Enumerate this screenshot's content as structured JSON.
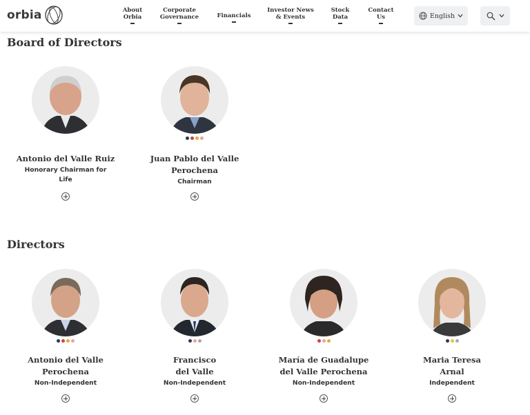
{
  "header": {
    "logo_text": "orbia",
    "nav": [
      {
        "line1": "About",
        "line2": "Orbia"
      },
      {
        "line1": "Corporate",
        "line2": "Governance"
      },
      {
        "line1": "Financials",
        "line2": ""
      },
      {
        "line1": "Investor News",
        "line2": "& Events"
      },
      {
        "line1": "Stock",
        "line2": "Data"
      },
      {
        "line1": "Contact",
        "line2": "Us"
      }
    ],
    "language": "English"
  },
  "sections": {
    "board_title": "Board of Directors",
    "directors_title": "Directors"
  },
  "board": [
    {
      "name_line1": "Antonio del Valle Ruiz",
      "name_line2": "",
      "role_line1": "Honorary Chairman for",
      "role_line2": "Life",
      "dots": []
    },
    {
      "name_line1": "Juan Pablo del Valle",
      "name_line2": "Perochena",
      "role_line1": "Chairman",
      "role_line2": "",
      "dots": [
        "#2b3a55",
        "#c8463c",
        "#e8a83a",
        "#e9a59a"
      ]
    }
  ],
  "directors": [
    {
      "name_line1": "Antonio del Valle",
      "name_line2": "Perochena",
      "role_line1": "Non-Independent",
      "dots": [
        "#2b3a55",
        "#c8463c",
        "#e8a83a",
        "#e9a59a"
      ]
    },
    {
      "name_line1": "Francisco",
      "name_line2": "del Valle",
      "role_line1": "Non-Independent",
      "dots": [
        "#2b3a55",
        "#e9a59a",
        "#a9a9a9"
      ]
    },
    {
      "name_line1": "María de Guadalupe",
      "name_line2": "del Valle Perochena",
      "role_line1": "Non-Independent",
      "dots": [
        "#c8463c",
        "#e9a59a",
        "#e8a83a"
      ]
    },
    {
      "name_line1": "Maria Teresa",
      "name_line2": "Arnal",
      "role_line1": "Independent",
      "dots": [
        "#2b3a55",
        "#e8c23a",
        "#a9a9a9"
      ]
    }
  ],
  "icons": {
    "logo": "orbia-logo-icon",
    "globe": "globe-icon",
    "chevron": "chevron-down-icon",
    "search": "search-icon",
    "expand": "plus-circle-icon"
  }
}
